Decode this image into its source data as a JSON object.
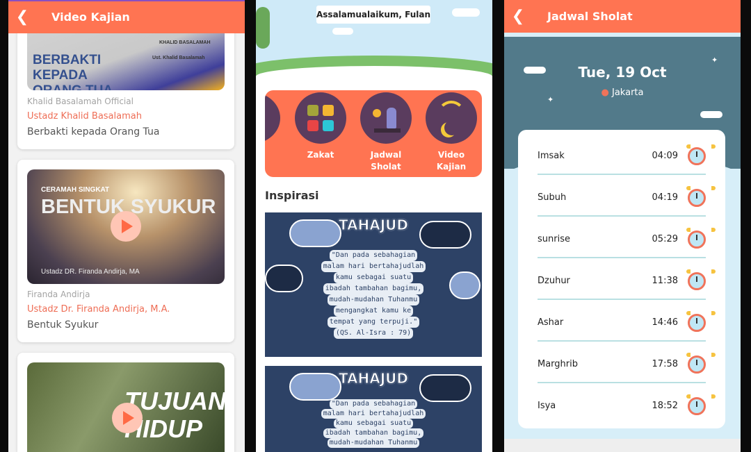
{
  "video": {
    "title": "Video Kajian",
    "items": [
      {
        "thumb_title": "BERBAKTI KEPADA ORANG TUA",
        "thumb_brand": "KHALID BASALAMAH",
        "thumb_sub": "Ust. Khalid Basalamah",
        "channel": "Khalid Basalamah Official",
        "ustadz": "Ustadz Khalid Basalamah",
        "title": "Berbakti kepada Orang Tua"
      },
      {
        "thumb_kicker": "CERAMAH SINGKAT",
        "thumb_title": "BENTUK SYUKUR",
        "thumb_sub": "Ustadz DR. Firanda Andirja, MA",
        "channel": "Firanda Andirja",
        "ustadz": "Ustadz Dr. Firanda Andirja, M.A.",
        "title": "Bentuk Syukur"
      },
      {
        "thumb_title": "TUJUAN HIDUP"
      }
    ]
  },
  "home": {
    "greeting": "Assalamualaikum, Fulan",
    "menu": [
      {
        "label": "Zakat",
        "icon": "calculator-icon"
      },
      {
        "label": "Jadwal Sholat",
        "icon": "prayer-icon"
      },
      {
        "label": "Video Kajian",
        "icon": "broadcast-moon-icon"
      }
    ],
    "section": "Inspirasi",
    "inspirasi": [
      {
        "title": "TAHAJUD",
        "lines": [
          "\"Dan pada sebahagian",
          "malam hari bertahajudlah",
          "kamu sebagai suatu",
          "ibadah tambahan bagimu,",
          "mudah-mudahan Tuhanmu",
          "mengangkat kamu ke",
          "tempat yang terpuji.\"",
          "(QS. Al-Isra : 79)"
        ]
      },
      {
        "title": "TAHAJUD",
        "lines": [
          "\"Dan pada sebahagian",
          "malam hari bertahajudlah",
          "kamu sebagai suatu",
          "ibadah tambahan bagimu,",
          "mudah-mudahan Tuhanmu"
        ]
      }
    ]
  },
  "jadwal": {
    "title": "Jadwal Sholat",
    "date": "Tue, 19 Oct",
    "location": "Jakarta",
    "times": [
      {
        "name": "Imsak",
        "time": "04:09"
      },
      {
        "name": "Subuh",
        "time": "04:19"
      },
      {
        "name": "sunrise",
        "time": "05:29"
      },
      {
        "name": "Dzuhur",
        "time": "11:38"
      },
      {
        "name": "Ashar",
        "time": "14:46"
      },
      {
        "name": "Marghrib",
        "time": "17:58"
      },
      {
        "name": "Isya",
        "time": "18:52"
      }
    ]
  },
  "colors": {
    "accent": "#ff7452",
    "purple": "#5a3c5e",
    "teal": "#527a8a"
  }
}
